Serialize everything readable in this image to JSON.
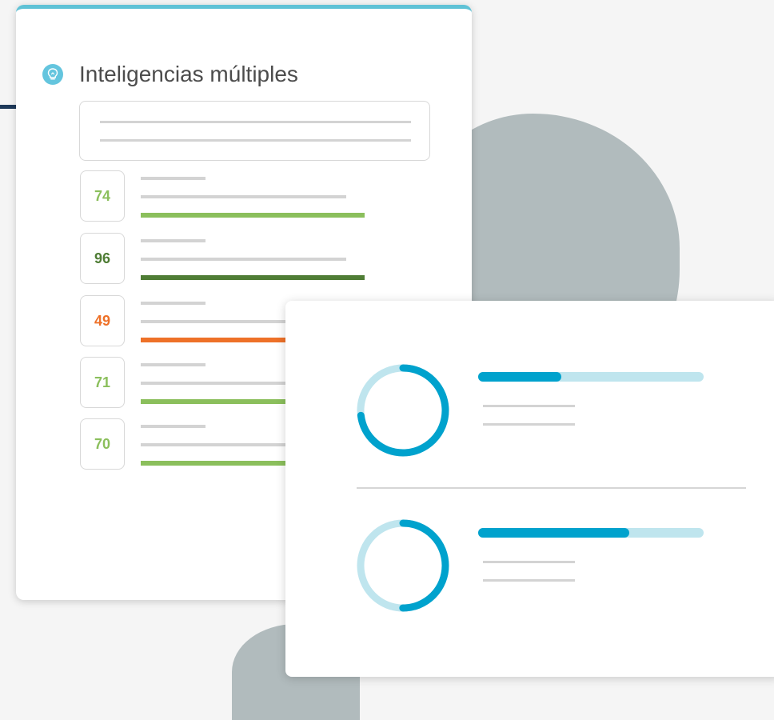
{
  "card": {
    "title": "Inteligencias múltiples",
    "icon": "lightbulb-icon",
    "accent_color": "#5fc2d6"
  },
  "scores": [
    {
      "value": "74",
      "color": "#8bbf5c",
      "fill": 1.0
    },
    {
      "value": "96",
      "color": "#4f7d35",
      "fill": 1.0
    },
    {
      "value": "49",
      "color": "#ee7128",
      "fill": 1.0
    },
    {
      "value": "71",
      "color": "#8bbf5c",
      "fill": 1.0
    },
    {
      "value": "70",
      "color": "#8bbf5c",
      "fill": 1.0
    }
  ],
  "results": [
    {
      "ring_fraction": 0.73,
      "bar_fraction": 0.37
    },
    {
      "ring_fraction": 0.5,
      "bar_fraction": 0.67
    }
  ],
  "colors": {
    "progress": "#00a2cd",
    "progress_track": "#bfe5ee",
    "blob": "#b1bbbd"
  }
}
